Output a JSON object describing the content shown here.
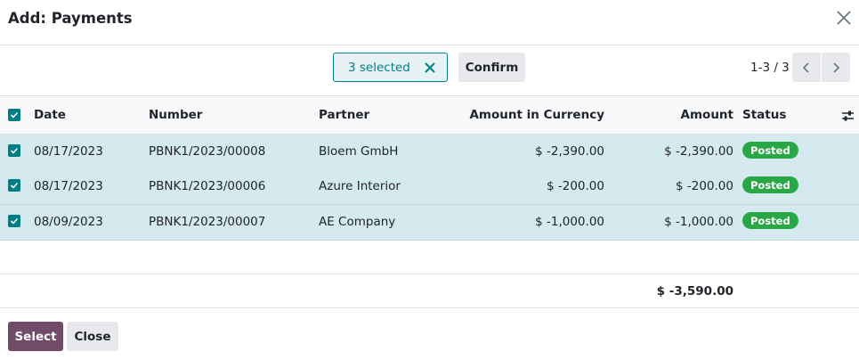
{
  "dialog": {
    "title": "Add: Payments"
  },
  "controls": {
    "selected_label": "3 selected",
    "confirm_label": "Confirm",
    "pager": "1-3 / 3"
  },
  "columns": {
    "date": "Date",
    "number": "Number",
    "partner": "Partner",
    "amount_currency": "Amount in Currency",
    "amount": "Amount",
    "status": "Status"
  },
  "rows": [
    {
      "date": "08/17/2023",
      "number": "PBNK1/2023/00008",
      "partner": "Bloem GmbH",
      "amount_currency": "$ -2,390.00",
      "amount": "$ -2,390.00",
      "status": "Posted",
      "selected": true
    },
    {
      "date": "08/17/2023",
      "number": "PBNK1/2023/00006",
      "partner": "Azure Interior",
      "amount_currency": "$ -200.00",
      "amount": "$ -200.00",
      "status": "Posted",
      "selected": true
    },
    {
      "date": "08/09/2023",
      "number": "PBNK1/2023/00007",
      "partner": "AE Company",
      "amount_currency": "$ -1,000.00",
      "amount": "$ -1,000.00",
      "status": "Posted",
      "selected": true
    }
  ],
  "totals": {
    "amount": "$ -3,590.00"
  },
  "footer": {
    "select_label": "Select",
    "close_label": "Close"
  },
  "colors": {
    "accent": "#017e84",
    "primary": "#714b67",
    "row_selected": "#d4eaee",
    "posted": "#28a745"
  },
  "icons": [
    "close-icon",
    "unselect-icon",
    "chevron-left-icon",
    "chevron-right-icon",
    "optional-columns-icon",
    "checkbox-icon"
  ]
}
